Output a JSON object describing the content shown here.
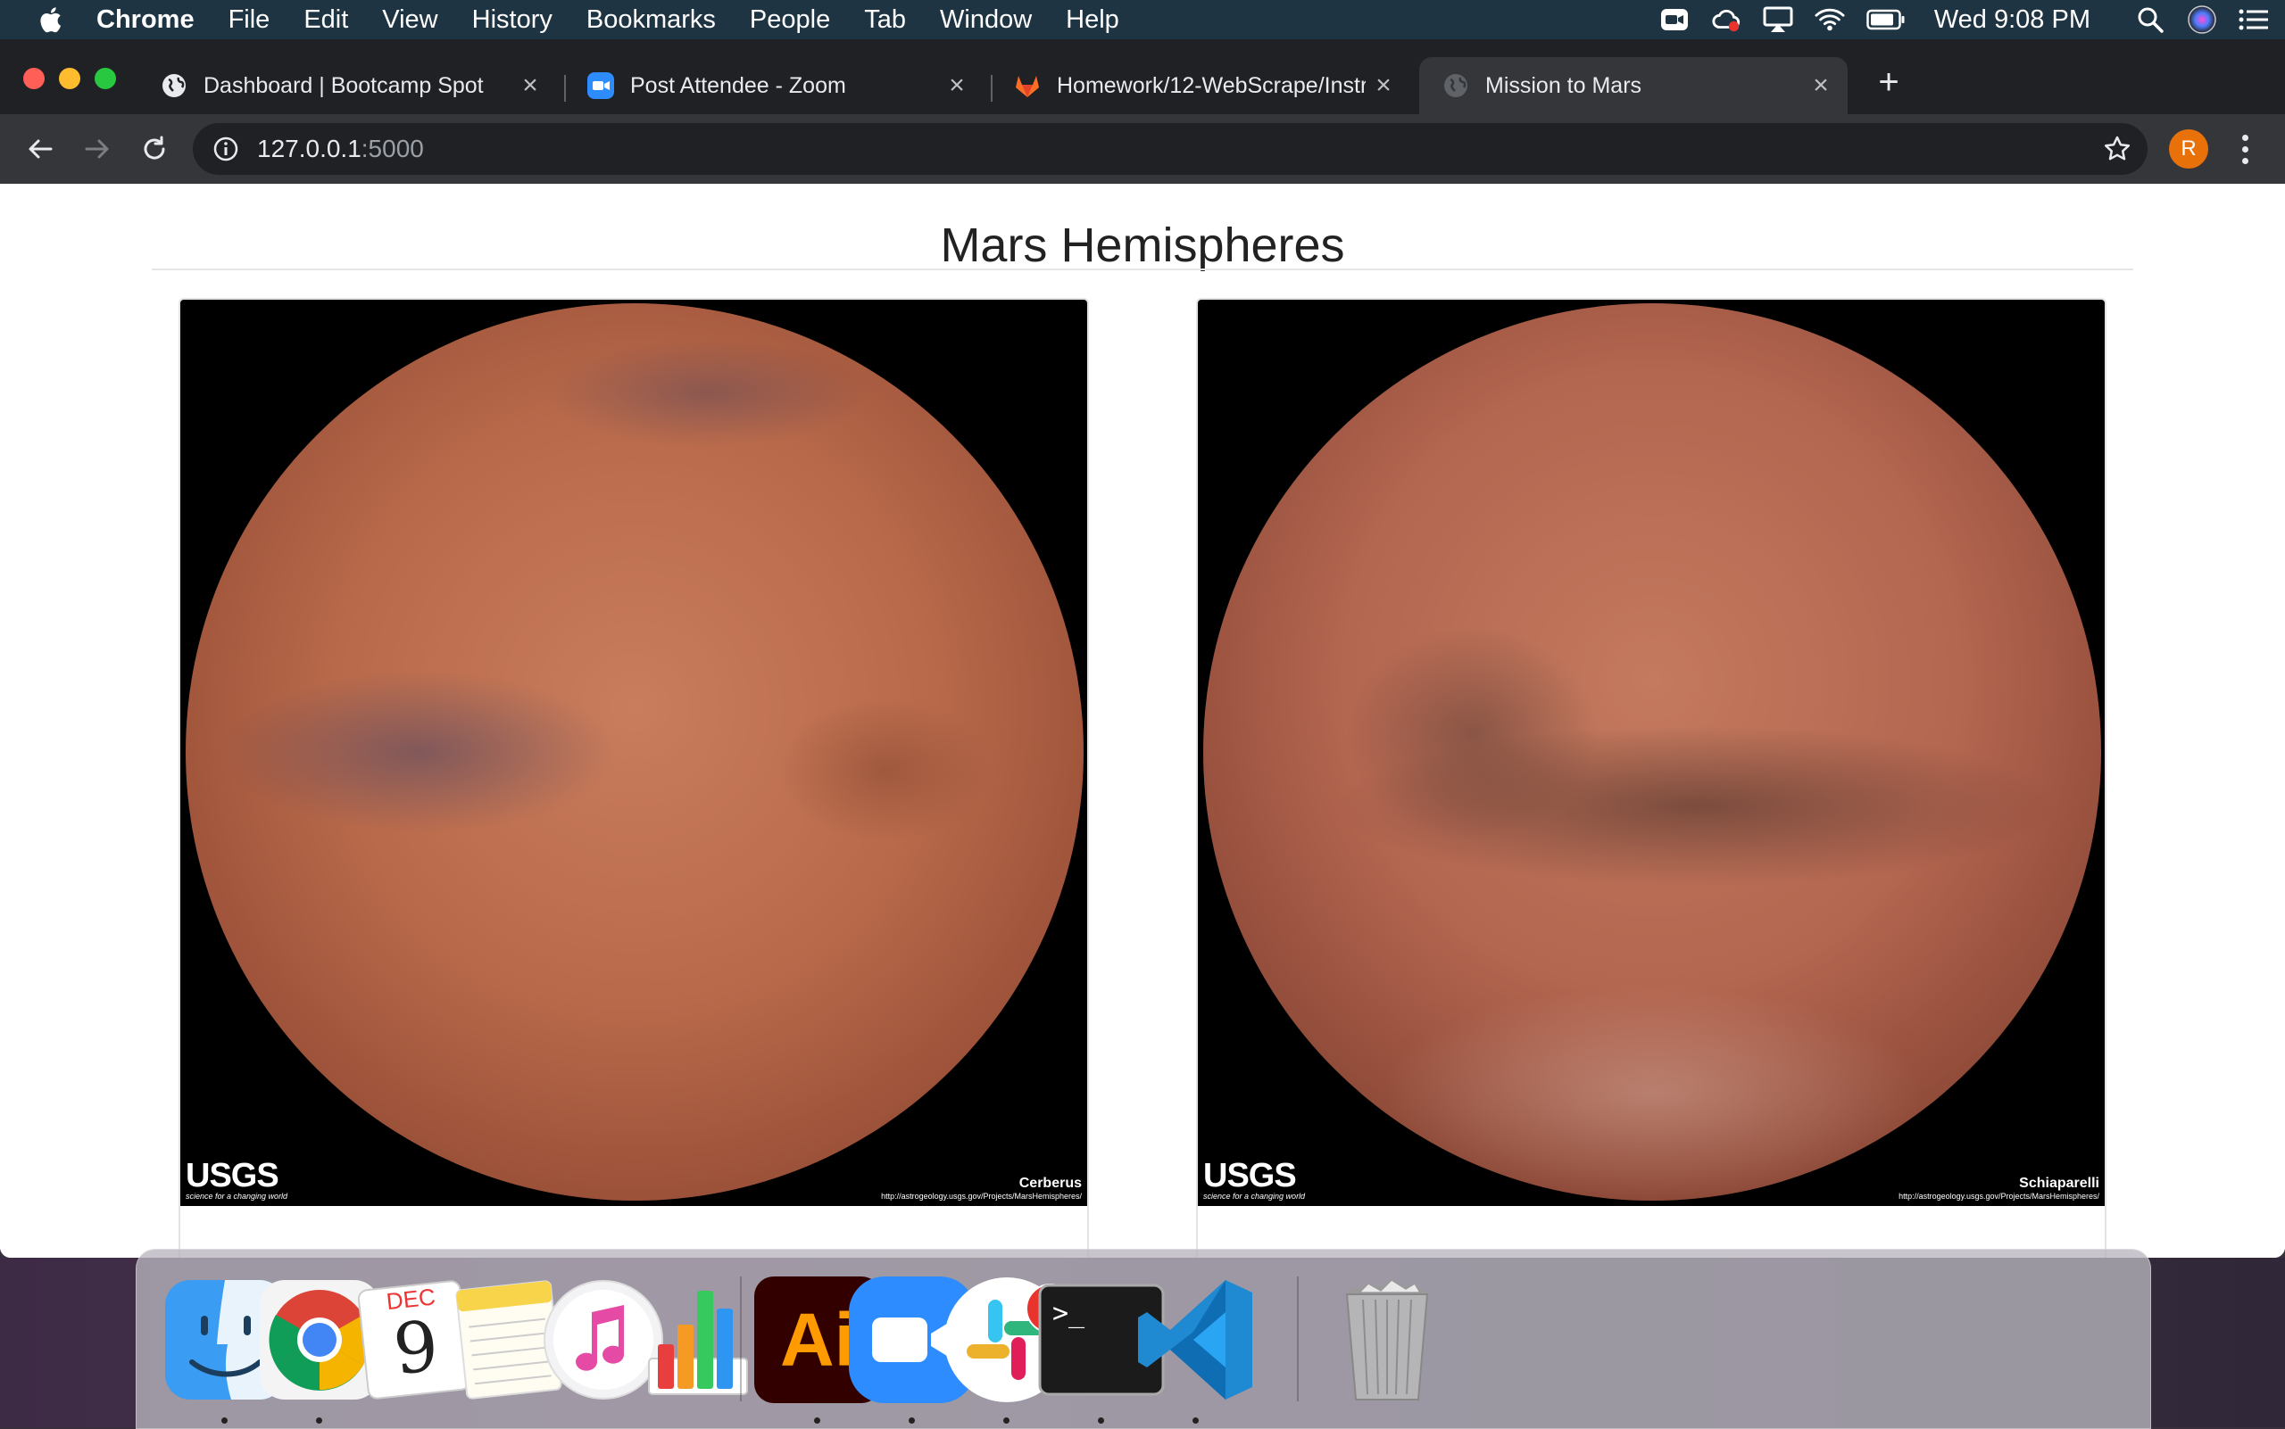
{
  "menubar": {
    "app_name": "Chrome",
    "menus": [
      "File",
      "Edit",
      "View",
      "History",
      "Bookmarks",
      "People",
      "Tab",
      "Window",
      "Help"
    ],
    "clock": "Wed 9:08 PM",
    "status_icons": [
      "zoom-status-icon",
      "creative-cloud-icon",
      "airplay-icon",
      "wifi-icon",
      "battery-icon",
      "spotlight-search-icon",
      "siri-icon",
      "notification-center-icon"
    ]
  },
  "browser": {
    "tabs": [
      {
        "title": "Dashboard | Bootcamp Spot",
        "icon": "globe-icon",
        "active": false
      },
      {
        "title": "Post Attendee - Zoom",
        "icon": "zoom-icon",
        "active": false
      },
      {
        "title": "Homework/12-WebScrape/Instr",
        "icon": "gitlab-icon",
        "active": false
      },
      {
        "title": "Mission to Mars",
        "icon": "globe-icon",
        "active": true
      }
    ],
    "url_host": "127.0.0.1",
    "url_port": ":5000",
    "profile_initial": "R"
  },
  "page": {
    "heading": "Mars Hemispheres",
    "hemispheres": [
      {
        "label": "Cerberus",
        "logo": "USGS",
        "logo_tag": "science for a changing world",
        "source_url": "http://astrogeology.usgs.gov/Projects/MarsHemispheres/"
      },
      {
        "label": "Schiaparelli",
        "logo": "USGS",
        "logo_tag": "science for a changing world",
        "source_url": "http://astrogeology.usgs.gov/Projects/MarsHemispheres/"
      }
    ]
  },
  "dock": {
    "apps": [
      "Finder",
      "Google Chrome",
      "Calendar",
      "Notes",
      "iTunes",
      "Numbers",
      "Adobe Illustrator",
      "Zoom",
      "Slack",
      "Terminal",
      "Visual Studio Code",
      "Trash"
    ],
    "calendar_month": "DEC",
    "calendar_day": "9",
    "illustrator_label": "Ai",
    "slack_badge": "1",
    "terminal_prompt": ">_"
  }
}
